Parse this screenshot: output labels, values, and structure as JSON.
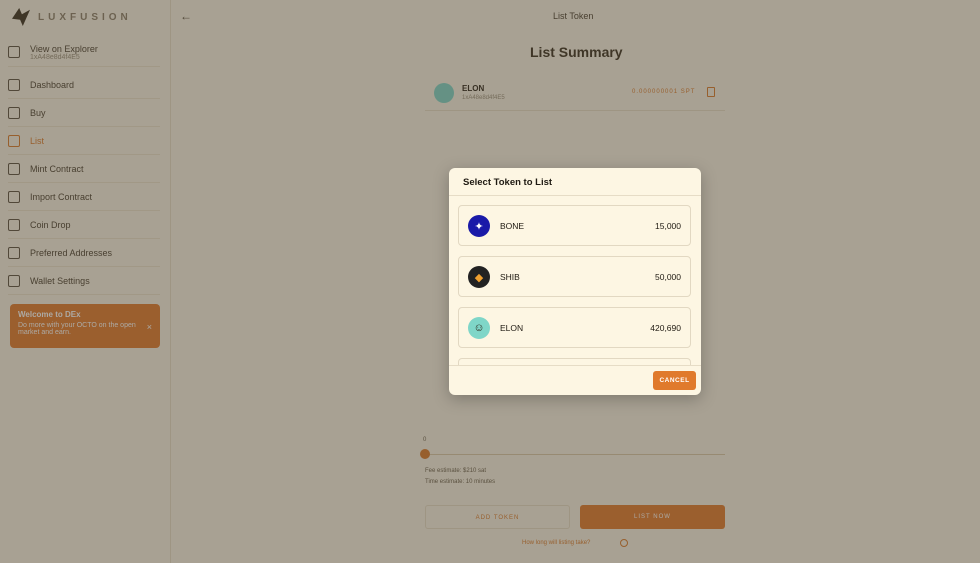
{
  "brand": {
    "name": "LUXFUSION"
  },
  "sidebar": {
    "explorer": {
      "label": "View on Explorer",
      "sub": "1xA48e8d4f4E5"
    },
    "items": [
      {
        "label": "Dashboard",
        "icon": "dashboard-icon"
      },
      {
        "label": "Buy",
        "icon": "buy-icon"
      },
      {
        "label": "List",
        "icon": "list-icon",
        "active": true
      },
      {
        "label": "Mint Contract",
        "icon": "mint-icon"
      },
      {
        "label": "Import Contract",
        "icon": "import-icon"
      },
      {
        "label": "Coin Drop",
        "icon": "coin-drop-icon"
      },
      {
        "label": "Preferred Addresses",
        "icon": "addresses-icon"
      },
      {
        "label": "Wallet Settings",
        "icon": "settings-icon"
      }
    ],
    "promo": {
      "title": "Welcome to DEx",
      "body": "Do more with your OCTO on the open market and earn.",
      "close": "×"
    }
  },
  "header": {
    "back": "←",
    "title": "List Token"
  },
  "summary": {
    "title": "List Summary",
    "token": {
      "name": "ELON",
      "sub": "1xA48e8d4f4E5",
      "amount": "0.000000001 SPT"
    }
  },
  "slider": {
    "label": "0"
  },
  "estimates": {
    "fee": "Fee estimate: $210 sat",
    "time": "Time estimate: 10 minutes"
  },
  "buttons": {
    "add_token": "ADD TOKEN",
    "list_now": "LIST NOW"
  },
  "help": {
    "text": "How long will listing take?"
  },
  "modal": {
    "title": "Select Token to List",
    "tokens": [
      {
        "name": "BONE",
        "amount": "15,000",
        "color": "#1a1aa8",
        "glyph": "✦"
      },
      {
        "name": "SHIB",
        "amount": "50,000",
        "color": "#222222",
        "glyph": "◆"
      },
      {
        "name": "ELON",
        "amount": "420,690",
        "color": "#7fd6c8",
        "glyph": "☺"
      }
    ],
    "cancel": "CANCEL"
  },
  "colors": {
    "accent": "#e07a2c",
    "background": "#f8f3e4",
    "modal": "#fdf6e3"
  }
}
